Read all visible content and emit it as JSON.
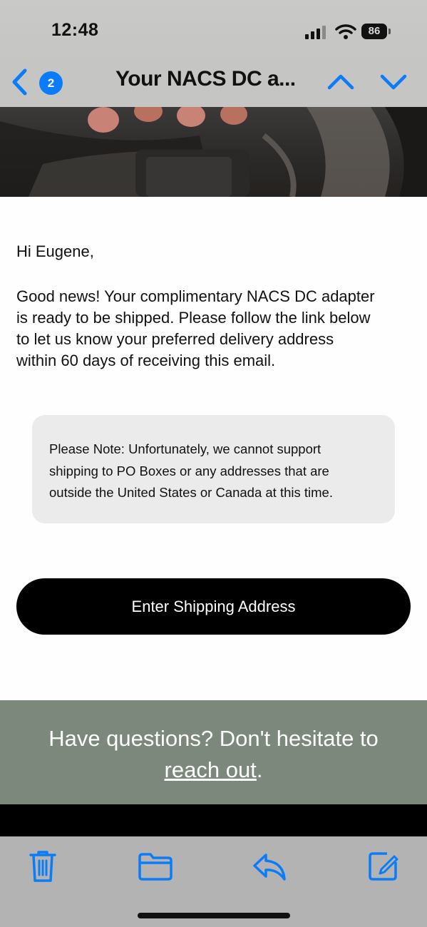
{
  "status_bar": {
    "time": "12:48",
    "battery": "86"
  },
  "nav": {
    "unread_count": "2",
    "title": "Your NACS DC a..."
  },
  "email": {
    "greeting": "Hi Eugene,",
    "body_lines": [
      "Good news! Your complimentary NACS DC adapter",
      "is ready to be shipped. Please follow the link below",
      "to let us know your preferred delivery address",
      "within 60 days of receiving this email."
    ],
    "note_lines": [
      "Please Note: Unfortunately, we cannot support",
      "shipping to PO Boxes or any addresses that are",
      "outside the United States or Canada at this time."
    ],
    "cta_label": "Enter Shipping Address",
    "footer_prefix": "Have questions? Don't hesitate to",
    "footer_link": "reach out",
    "footer_suffix": "."
  },
  "toolbar": {
    "icons": [
      "trash-icon",
      "folder-icon",
      "reply-icon",
      "compose-icon"
    ]
  },
  "colors": {
    "accent": "#0a7cf7",
    "footer_bg": "#7c887b",
    "cta_bg": "#000000",
    "note_bg": "#ebebeb"
  }
}
